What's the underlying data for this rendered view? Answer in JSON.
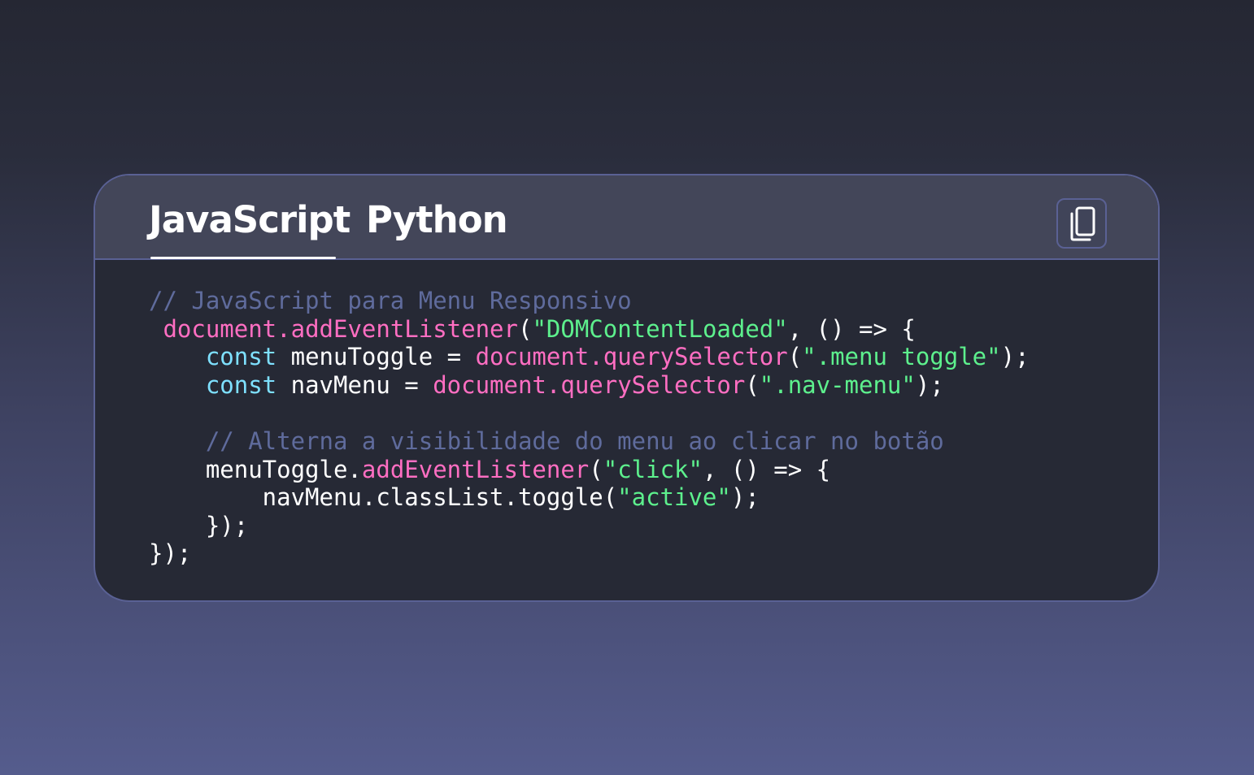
{
  "tabs": [
    {
      "label": "JavaScript",
      "active": true
    },
    {
      "label": "Python",
      "active": false
    }
  ],
  "copy_button": {
    "icon": "copy-icon"
  },
  "colors": {
    "background_top": "#252733",
    "background_bottom": "#555c8d",
    "card_body": "#262935",
    "card_header": "#434659",
    "border": "#5a6194",
    "comment": "#5f6b9c",
    "function": "#ff6ec2",
    "string": "#5df08d",
    "keyword": "#7ee0ff",
    "text": "#ffffff"
  },
  "code": {
    "language": "JavaScript",
    "lines": [
      [
        {
          "t": "// JavaScript para Menu Responsivo",
          "k": "comment"
        }
      ],
      [
        {
          "t": " ",
          "k": "plain"
        },
        {
          "t": "document.addEventListener",
          "k": "func"
        },
        {
          "t": "(",
          "k": "plain"
        },
        {
          "t": "\"DOMContentLoaded\"",
          "k": "str"
        },
        {
          "t": ", () => {",
          "k": "plain"
        }
      ],
      [
        {
          "t": "    ",
          "k": "plain"
        },
        {
          "t": "const",
          "k": "kw"
        },
        {
          "t": " menuToggle = ",
          "k": "plain"
        },
        {
          "t": "document.querySelector",
          "k": "func"
        },
        {
          "t": "(",
          "k": "plain"
        },
        {
          "t": "\".menu toggle\"",
          "k": "str"
        },
        {
          "t": ");",
          "k": "plain"
        }
      ],
      [
        {
          "t": "    ",
          "k": "plain"
        },
        {
          "t": "const",
          "k": "kw"
        },
        {
          "t": " navMenu = ",
          "k": "plain"
        },
        {
          "t": "document.querySelector",
          "k": "func"
        },
        {
          "t": "(",
          "k": "plain"
        },
        {
          "t": "\".nav-menu\"",
          "k": "str"
        },
        {
          "t": ");",
          "k": "plain"
        }
      ],
      [
        {
          "t": "",
          "k": "plain"
        }
      ],
      [
        {
          "t": "    ",
          "k": "plain"
        },
        {
          "t": "// Alterna a visibilidade do menu ao clicar no botão",
          "k": "comment"
        }
      ],
      [
        {
          "t": "    menuToggle.",
          "k": "plain"
        },
        {
          "t": "addEventListener",
          "k": "func"
        },
        {
          "t": "(",
          "k": "plain"
        },
        {
          "t": "\"click\"",
          "k": "str"
        },
        {
          "t": ", () => {",
          "k": "plain"
        }
      ],
      [
        {
          "t": "        navMenu.classList.toggle(",
          "k": "plain"
        },
        {
          "t": "\"active\"",
          "k": "str"
        },
        {
          "t": ");",
          "k": "plain"
        }
      ],
      [
        {
          "t": "    });",
          "k": "plain"
        }
      ],
      [
        {
          "t": "});",
          "k": "plain"
        }
      ]
    ]
  }
}
